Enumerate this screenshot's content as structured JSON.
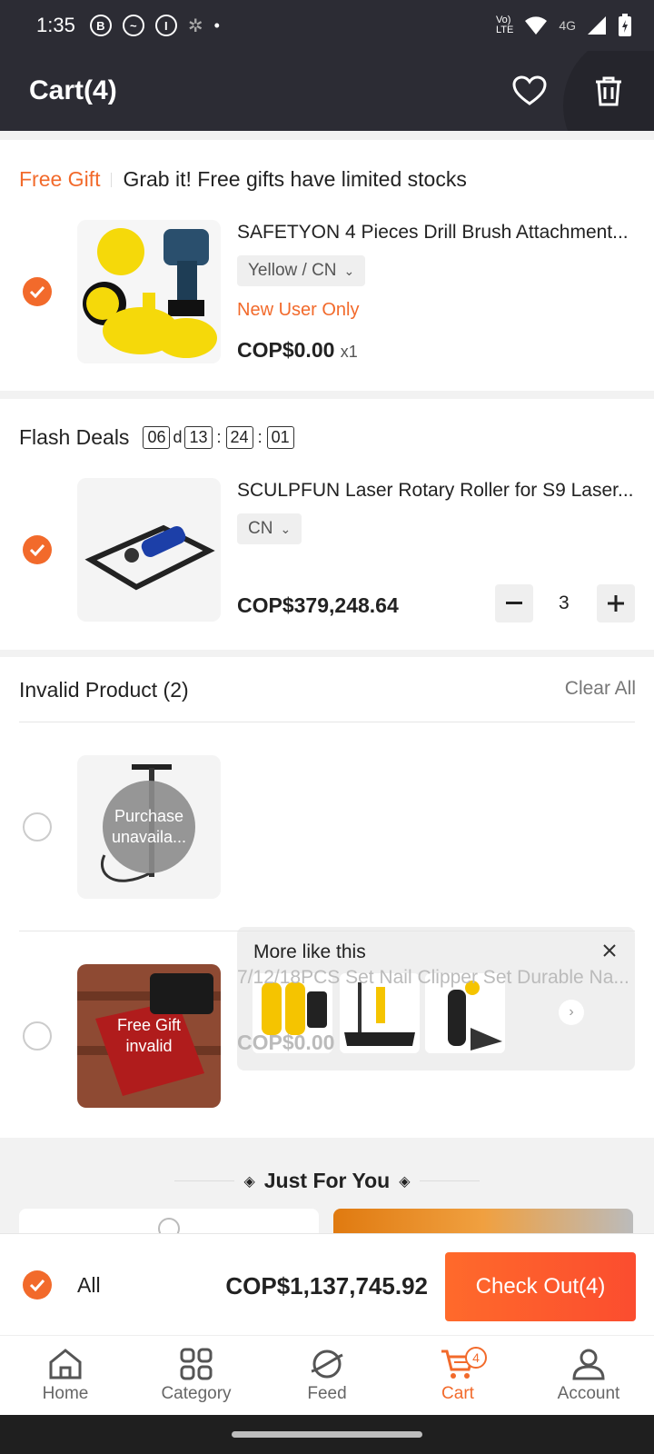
{
  "status_bar": {
    "time": "1:35",
    "network": "4G"
  },
  "header": {
    "title": "Cart(4)"
  },
  "free_gift": {
    "label": "Free Gift",
    "message": "Grab it! Free gifts have limited stocks",
    "product": {
      "title": "SAFETYON 4 Pieces Drill Brush Attachment...",
      "variant": "Yellow / CN",
      "tag": "New User Only",
      "price": "COP$0.00",
      "quantity": "x1"
    }
  },
  "flash_deals": {
    "label": "Flash Deals",
    "timer": {
      "days": "06",
      "day_unit": "d",
      "hours": "13",
      "minutes": "24",
      "seconds": "01",
      "sep": ":"
    },
    "product": {
      "title": "SCULPFUN Laser Rotary Roller for S9 Laser...",
      "variant": "CN",
      "price": "COP$379,248.64",
      "quantity": "3"
    }
  },
  "invalid": {
    "title": "Invalid Product (2)",
    "clear_label": "Clear All",
    "item1": {
      "overlay": "Purchase unavaila...",
      "more_title": "More like this"
    },
    "item2": {
      "title": "7/12/18PCS Set Nail Clipper Set Durable Na...",
      "price": "COP$0.00",
      "overlay": "Free Gift invalid"
    }
  },
  "just_for_you": {
    "title": "Just For You"
  },
  "bottom_bar": {
    "all_label": "All",
    "total": "COP$1,137,745.92",
    "checkout": "Check Out(4)"
  },
  "nav": {
    "items": [
      {
        "label": "Home",
        "icon": "home-icon"
      },
      {
        "label": "Category",
        "icon": "category-icon"
      },
      {
        "label": "Feed",
        "icon": "feed-icon"
      },
      {
        "label": "Cart",
        "icon": "cart-icon",
        "badge": "4"
      },
      {
        "label": "Account",
        "icon": "account-icon"
      }
    ]
  },
  "colors": {
    "accent": "#f26a2b",
    "header": "#2c2c34"
  }
}
